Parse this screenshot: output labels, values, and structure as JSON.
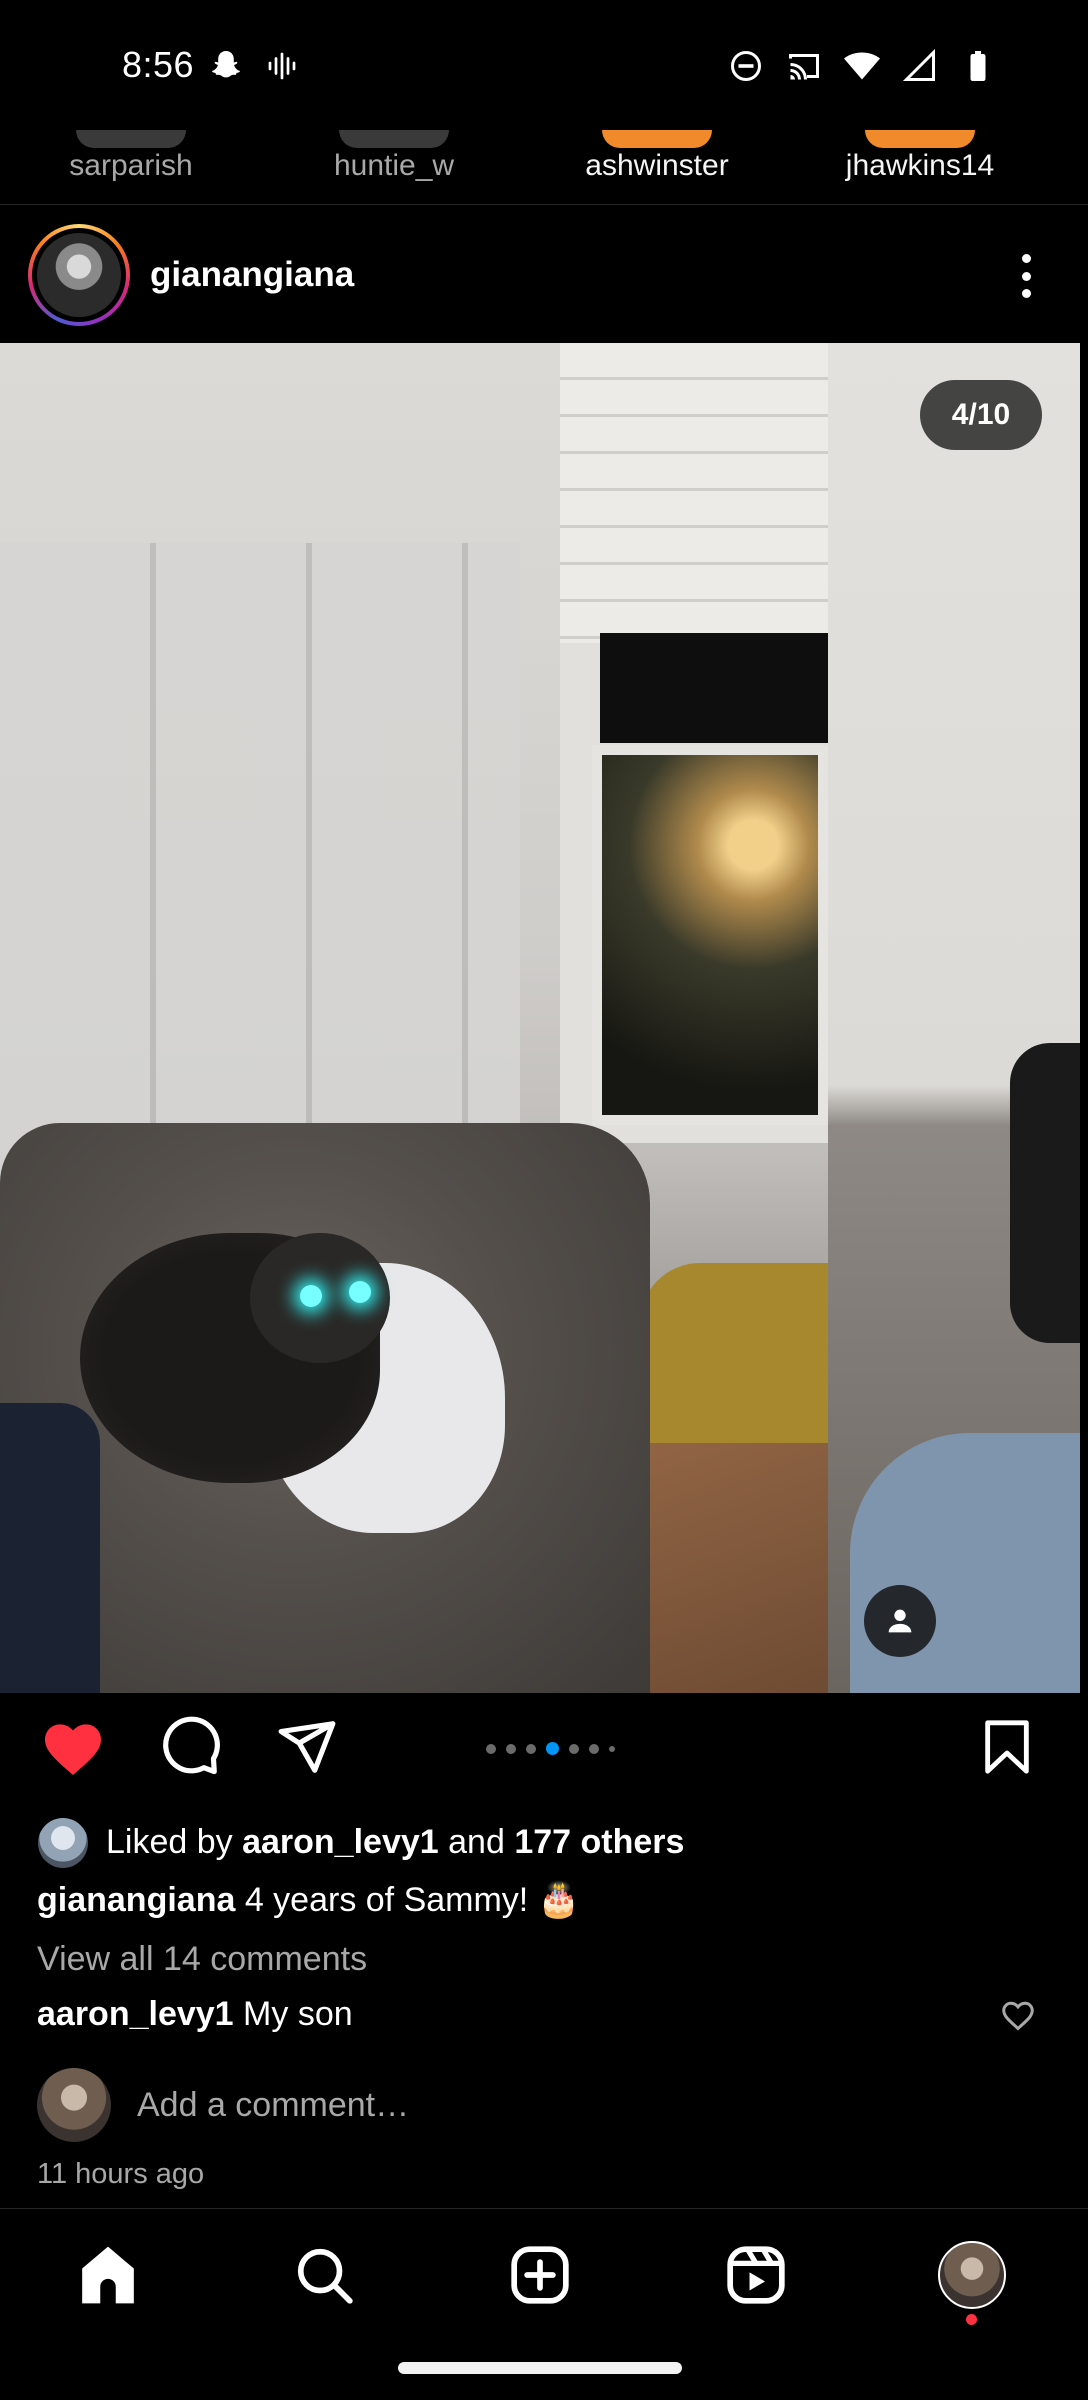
{
  "status_bar": {
    "time": "8:56",
    "left_icons": [
      "snapchat-icon",
      "voice-recorder-icon"
    ],
    "right_icons": [
      "do-not-disturb-icon",
      "cast-icon",
      "wifi-icon",
      "signal-icon",
      "battery-icon"
    ]
  },
  "stories": [
    {
      "name": "sarparish",
      "seen": true
    },
    {
      "name": "huntie_w",
      "seen": true
    },
    {
      "name": "ashwinster",
      "seen": false
    },
    {
      "name": "jhawkins14",
      "seen": false
    }
  ],
  "post": {
    "username": "gianangiana",
    "carousel_counter": "4/10",
    "carousel_index": 4,
    "carousel_total": 10,
    "liked": true,
    "likes": {
      "prefix": "Liked by",
      "user": "aaron_levy1",
      "joiner": "and",
      "others": "177 others"
    },
    "caption": {
      "user": "gianangiana",
      "text": "4 years of Sammy! 🎂"
    },
    "view_comments": "View all 14 comments",
    "comment": {
      "user": "aaron_levy1",
      "text": "My son"
    },
    "add_comment_placeholder": "Add a comment…",
    "time_ago": "11 hours ago"
  },
  "colors": {
    "like_red": "#ff3040",
    "active_dot": "#0095f6",
    "secondary_text": "#a8a8a8"
  },
  "bottom_nav": [
    "home-icon",
    "search-icon",
    "create-icon",
    "reels-icon",
    "profile-avatar"
  ]
}
